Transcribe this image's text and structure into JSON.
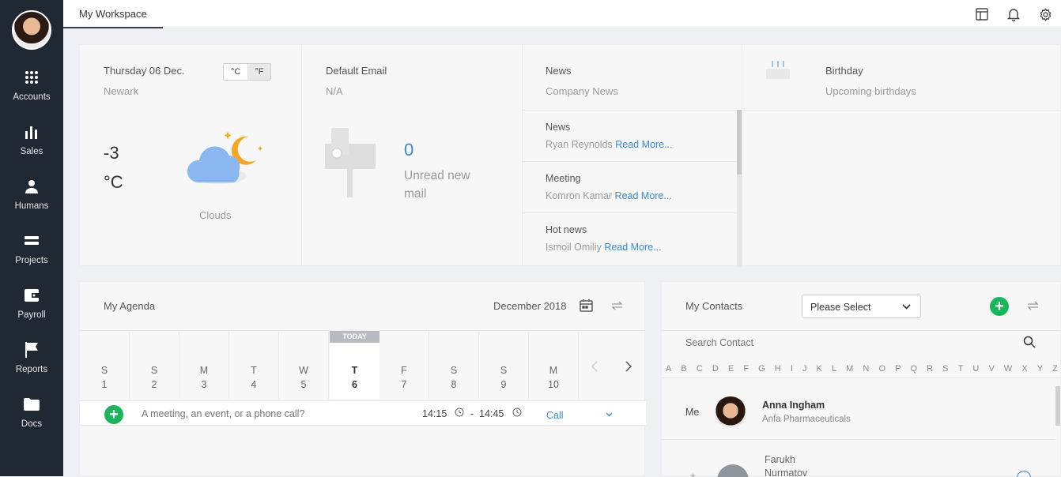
{
  "sidebar": {
    "items": [
      {
        "label": "Accounts",
        "icon": "grid-icon"
      },
      {
        "label": "Sales",
        "icon": "bar-chart-icon"
      },
      {
        "label": "Humans",
        "icon": "person-icon"
      },
      {
        "label": "Projects",
        "icon": "projects-icon"
      },
      {
        "label": "Payroll",
        "icon": "wallet-icon"
      },
      {
        "label": "Reports",
        "icon": "flag-icon"
      },
      {
        "label": "Docs",
        "icon": "folder-icon"
      }
    ]
  },
  "header": {
    "tab_label": "My Workspace"
  },
  "weather": {
    "date": "Thursday 06 Dec.",
    "city": "Newark",
    "unit_c": "°C",
    "unit_f": "°F",
    "temp": "-3",
    "temp_unit": "°C",
    "condition": "Clouds"
  },
  "email": {
    "title": "Default Email",
    "address": "N/A",
    "count": "0",
    "label_line1": "Unread new",
    "label_line2": "mail"
  },
  "news": {
    "title": "News",
    "subtitle": "Company News",
    "items": [
      {
        "title": "News",
        "author": "Ryan Reynolds",
        "link": "Read More..."
      },
      {
        "title": "Meeting",
        "author": "Komron Kamar",
        "link": "Read More..."
      },
      {
        "title": "Hot news",
        "author": "Ismoil Omiliy",
        "link": "Read More..."
      }
    ]
  },
  "birthday": {
    "title": "Birthday",
    "subtitle": "Upcoming birthdays"
  },
  "agenda": {
    "title": "My Agenda",
    "month": "December 2018",
    "today_tag": "TODAY",
    "days": [
      {
        "dow": "S",
        "num": "1"
      },
      {
        "dow": "S",
        "num": "2"
      },
      {
        "dow": "M",
        "num": "3"
      },
      {
        "dow": "T",
        "num": "4"
      },
      {
        "dow": "W",
        "num": "5"
      },
      {
        "dow": "T",
        "num": "6"
      },
      {
        "dow": "F",
        "num": "7"
      },
      {
        "dow": "S",
        "num": "8"
      },
      {
        "dow": "S",
        "num": "9"
      },
      {
        "dow": "M",
        "num": "10"
      }
    ],
    "input_placeholder": "A meeting, an event, or a phone call?",
    "time_from": "14:15",
    "time_sep": "-",
    "time_to": "14:45",
    "type": "Call"
  },
  "contacts": {
    "title": "My Contacts",
    "select_value": "Please Select",
    "search_placeholder": "Search Contact",
    "letters": [
      "A",
      "B",
      "C",
      "D",
      "E",
      "F",
      "G",
      "H",
      "I",
      "J",
      "K",
      "L",
      "M",
      "N",
      "O",
      "P",
      "Q",
      "R",
      "S",
      "T",
      "U",
      "V",
      "W",
      "X",
      "Y",
      "Z"
    ],
    "me_label": "Me",
    "me_name": "Anna Ingham",
    "me_company": "Anfa Pharmaceuticals",
    "next_first": "Farukh",
    "next_last": "Nurmatov"
  },
  "colors": {
    "sidebar": "#1f2833",
    "accent_blue": "#3a8bd6",
    "green": "#1bb55c"
  }
}
